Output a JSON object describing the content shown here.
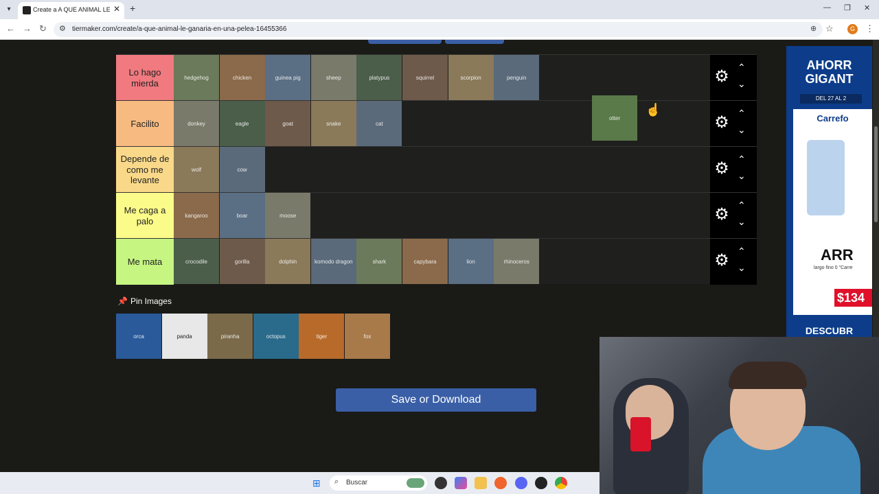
{
  "browser": {
    "tab_title": "Create a A QUE ANIMAL LE GANARIA EN UNA PELEA",
    "url": "tiermaker.com/create/a-que-animal-le-ganaria-en-una-pelea-16455366",
    "profile_initial": "G"
  },
  "tiers": [
    {
      "label": "Lo hago mierda",
      "color": "#f07a7f",
      "items": [
        "hedgehog",
        "chicken",
        "guinea pig",
        "sheep",
        "platypus",
        "squirrel",
        "scorpion",
        "penguin"
      ]
    },
    {
      "label": "Facilito",
      "color": "#f7bb82",
      "items": [
        "donkey",
        "eagle",
        "goat",
        "snake",
        "cat"
      ]
    },
    {
      "label": "Depende de como me levante",
      "color": "#f9d989",
      "items": [
        "wolf",
        "cow"
      ]
    },
    {
      "label": "Me caga a palo",
      "color": "#fbfb8a",
      "items": [
        "kangaroo",
        "boar",
        "moose"
      ]
    },
    {
      "label": "Me mata",
      "color": "#c6f582",
      "items": [
        "crocodile",
        "gorilla",
        "dolphin",
        "komodo dragon",
        "shark",
        "capybara",
        "lion",
        "rhinoceros"
      ]
    }
  ],
  "dragging_item": "otter",
  "pin_section": {
    "title": "Pin Images",
    "items": [
      "orca",
      "panda",
      "piranha",
      "octopus",
      "tiger",
      "fox"
    ]
  },
  "save_button": "Save or Download",
  "ad": {
    "headline": "AHORR GIGANT",
    "date": "DEL 27 AL 2",
    "brand": "Carrefo",
    "product_big": "ARR",
    "product_sub": "largo fino 0 \"Carre",
    "price": "$134",
    "footer": "DESCUBR"
  },
  "taskbar": {
    "search_placeholder": "Buscar"
  },
  "colors": {
    "page_bg": "#1a1a17",
    "button_blue": "#3a5fa6",
    "control_bg": "#000000"
  },
  "icons": [
    "gear-icon",
    "chevron-up-icon",
    "chevron-down-icon",
    "pin-icon",
    "hand-cursor-icon"
  ]
}
